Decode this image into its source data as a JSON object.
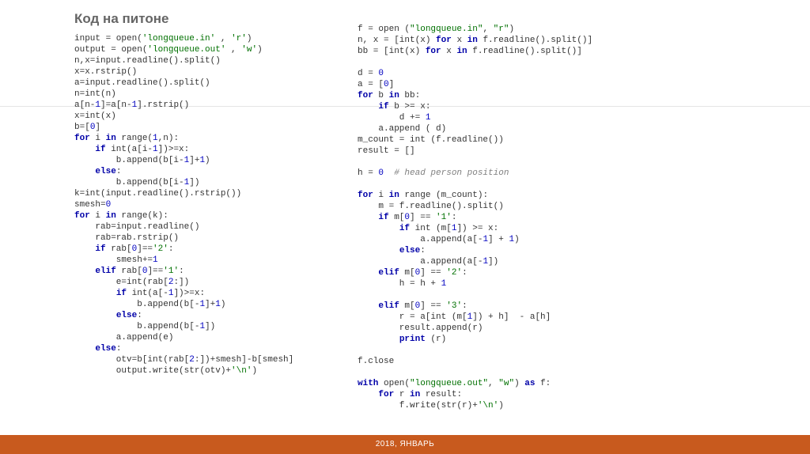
{
  "title": "Код на питоне",
  "footer": "2018, ЯНВАРЬ",
  "codeLeft": [
    {
      "segs": [
        [
          "",
          "input = open("
        ],
        [
          "str",
          "'longqueue.in'"
        ],
        [
          "",
          " , "
        ],
        [
          "str",
          "'r'"
        ],
        [
          "",
          ")"
        ]
      ]
    },
    {
      "segs": [
        [
          "",
          "output = open("
        ],
        [
          "str",
          "'longqueue.out'"
        ],
        [
          "",
          " , "
        ],
        [
          "str",
          "'w'"
        ],
        [
          "",
          ")"
        ]
      ]
    },
    {
      "segs": [
        [
          "",
          "n,x=input.readline().split()"
        ]
      ]
    },
    {
      "segs": [
        [
          "",
          "x=x.rstrip()"
        ]
      ]
    },
    {
      "segs": [
        [
          "",
          "a=input.readline().split()"
        ]
      ]
    },
    {
      "segs": [
        [
          "",
          "n=int(n)"
        ]
      ]
    },
    {
      "segs": [
        [
          "",
          "a[n-"
        ],
        [
          "num",
          "1"
        ],
        [
          "",
          "]=a[n-"
        ],
        [
          "num",
          "1"
        ],
        [
          "",
          "].rstrip()"
        ]
      ]
    },
    {
      "segs": [
        [
          "",
          "x=int(x)"
        ]
      ]
    },
    {
      "segs": [
        [
          "",
          "b=["
        ],
        [
          "num",
          "0"
        ],
        [
          "",
          "]"
        ]
      ]
    },
    {
      "segs": [
        [
          "kw",
          "for"
        ],
        [
          "",
          " i "
        ],
        [
          "kw",
          "in"
        ],
        [
          "",
          " range("
        ],
        [
          "num",
          "1"
        ],
        [
          "",
          ",n):"
        ]
      ]
    },
    {
      "segs": [
        [
          "",
          "    "
        ],
        [
          "kw",
          "if"
        ],
        [
          "",
          " int(a[i-"
        ],
        [
          "num",
          "1"
        ],
        [
          "",
          "])>=x:"
        ]
      ]
    },
    {
      "segs": [
        [
          "",
          "        b.append(b[i-"
        ],
        [
          "num",
          "1"
        ],
        [
          "",
          "]+"
        ],
        [
          "num",
          "1"
        ],
        [
          "",
          ")"
        ]
      ]
    },
    {
      "segs": [
        [
          "",
          "    "
        ],
        [
          "kw",
          "else"
        ],
        [
          "",
          ":"
        ]
      ]
    },
    {
      "segs": [
        [
          "",
          "        b.append(b[i-"
        ],
        [
          "num",
          "1"
        ],
        [
          "",
          "])"
        ]
      ]
    },
    {
      "segs": [
        [
          "",
          "k=int(input.readline().rstrip())"
        ]
      ]
    },
    {
      "segs": [
        [
          "",
          "smesh="
        ],
        [
          "num",
          "0"
        ]
      ]
    },
    {
      "segs": [
        [
          "kw",
          "for"
        ],
        [
          "",
          " i "
        ],
        [
          "kw",
          "in"
        ],
        [
          "",
          " range(k):"
        ]
      ]
    },
    {
      "segs": [
        [
          "",
          "    rab=input.readline()"
        ]
      ]
    },
    {
      "segs": [
        [
          "",
          "    rab=rab.rstrip()"
        ]
      ]
    },
    {
      "segs": [
        [
          "",
          "    "
        ],
        [
          "kw",
          "if"
        ],
        [
          "",
          " rab["
        ],
        [
          "num",
          "0"
        ],
        [
          "",
          "]=="
        ],
        [
          "str",
          "'2'"
        ],
        [
          "",
          ":"
        ]
      ]
    },
    {
      "segs": [
        [
          "",
          "        smesh+="
        ],
        [
          "num",
          "1"
        ]
      ]
    },
    {
      "segs": [
        [
          "",
          "    "
        ],
        [
          "kw",
          "elif"
        ],
        [
          "",
          " rab["
        ],
        [
          "num",
          "0"
        ],
        [
          "",
          "]=="
        ],
        [
          "str",
          "'1'"
        ],
        [
          "",
          ":"
        ]
      ]
    },
    {
      "segs": [
        [
          "",
          "        e=int(rab["
        ],
        [
          "num",
          "2"
        ],
        [
          "",
          ":])"
        ]
      ]
    },
    {
      "segs": [
        [
          "",
          "        "
        ],
        [
          "kw",
          "if"
        ],
        [
          "",
          " int(a[-"
        ],
        [
          "num",
          "1"
        ],
        [
          "",
          "])>=x:"
        ]
      ]
    },
    {
      "segs": [
        [
          "",
          "            b.append(b[-"
        ],
        [
          "num",
          "1"
        ],
        [
          "",
          "]+"
        ],
        [
          "num",
          "1"
        ],
        [
          "",
          ")"
        ]
      ]
    },
    {
      "segs": [
        [
          "",
          "        "
        ],
        [
          "kw",
          "else"
        ],
        [
          "",
          ":"
        ]
      ]
    },
    {
      "segs": [
        [
          "",
          "            b.append(b[-"
        ],
        [
          "num",
          "1"
        ],
        [
          "",
          "])"
        ]
      ]
    },
    {
      "segs": [
        [
          "",
          "        a.append(e)"
        ]
      ]
    },
    {
      "segs": [
        [
          "",
          "    "
        ],
        [
          "kw",
          "else"
        ],
        [
          "",
          ":"
        ]
      ]
    },
    {
      "segs": [
        [
          "",
          "        otv=b[int(rab["
        ],
        [
          "num",
          "2"
        ],
        [
          "",
          ":])+smesh]-b[smesh]"
        ]
      ]
    },
    {
      "segs": [
        [
          "",
          "        output.write(str(otv)+"
        ],
        [
          "str",
          "'\\n'"
        ],
        [
          "",
          ")"
        ]
      ]
    }
  ],
  "codeRight": [
    {
      "segs": [
        [
          "",
          "f = open ("
        ],
        [
          "str",
          "\"longqueue.in\""
        ],
        [
          "",
          ", "
        ],
        [
          "str",
          "\"r\""
        ],
        [
          "",
          ")"
        ]
      ]
    },
    {
      "segs": [
        [
          "",
          "n, x = [int(x) "
        ],
        [
          "kw",
          "for"
        ],
        [
          "",
          " x "
        ],
        [
          "kw",
          "in"
        ],
        [
          "",
          " f.readline().split()]"
        ]
      ]
    },
    {
      "segs": [
        [
          "",
          "bb = [int(x) "
        ],
        [
          "kw",
          "for"
        ],
        [
          "",
          " x "
        ],
        [
          "kw",
          "in"
        ],
        [
          "",
          " f.readline().split()]"
        ]
      ]
    },
    {
      "segs": [
        [
          "",
          ""
        ]
      ]
    },
    {
      "segs": [
        [
          "",
          "d = "
        ],
        [
          "num",
          "0"
        ]
      ]
    },
    {
      "segs": [
        [
          "",
          "a = ["
        ],
        [
          "num",
          "0"
        ],
        [
          "",
          "]"
        ]
      ]
    },
    {
      "segs": [
        [
          "kw",
          "for"
        ],
        [
          "",
          " b "
        ],
        [
          "kw",
          "in"
        ],
        [
          "",
          " bb:"
        ]
      ]
    },
    {
      "segs": [
        [
          "",
          "    "
        ],
        [
          "kw",
          "if"
        ],
        [
          "",
          " b >= x:"
        ]
      ]
    },
    {
      "segs": [
        [
          "",
          "        d += "
        ],
        [
          "num",
          "1"
        ]
      ]
    },
    {
      "segs": [
        [
          "",
          "    a.append ( d)"
        ]
      ]
    },
    {
      "segs": [
        [
          "",
          "m_count = int (f.readline())"
        ]
      ]
    },
    {
      "segs": [
        [
          "",
          "result = []"
        ]
      ]
    },
    {
      "segs": [
        [
          "",
          ""
        ]
      ]
    },
    {
      "segs": [
        [
          "",
          "h = "
        ],
        [
          "num",
          "0"
        ],
        [
          "",
          "  "
        ],
        [
          "cmt",
          "# head person position"
        ]
      ]
    },
    {
      "segs": [
        [
          "",
          ""
        ]
      ]
    },
    {
      "segs": [
        [
          "kw",
          "for"
        ],
        [
          "",
          " i "
        ],
        [
          "kw",
          "in"
        ],
        [
          "",
          " range (m_count):"
        ]
      ]
    },
    {
      "segs": [
        [
          "",
          "    m = f.readline().split()"
        ]
      ]
    },
    {
      "segs": [
        [
          "",
          "    "
        ],
        [
          "kw",
          "if"
        ],
        [
          "",
          " m["
        ],
        [
          "num",
          "0"
        ],
        [
          "",
          "] == "
        ],
        [
          "str",
          "'1'"
        ],
        [
          "",
          ":"
        ]
      ]
    },
    {
      "segs": [
        [
          "",
          "        "
        ],
        [
          "kw",
          "if"
        ],
        [
          "",
          " int (m["
        ],
        [
          "num",
          "1"
        ],
        [
          "",
          "]) >= x:"
        ]
      ]
    },
    {
      "segs": [
        [
          "",
          "            a.append(a[-"
        ],
        [
          "num",
          "1"
        ],
        [
          "",
          "] + "
        ],
        [
          "num",
          "1"
        ],
        [
          "",
          ")"
        ]
      ]
    },
    {
      "segs": [
        [
          "",
          "        "
        ],
        [
          "kw",
          "else"
        ],
        [
          "",
          ":"
        ]
      ]
    },
    {
      "segs": [
        [
          "",
          "            a.append(a[-"
        ],
        [
          "num",
          "1"
        ],
        [
          "",
          "])"
        ]
      ]
    },
    {
      "segs": [
        [
          "",
          "    "
        ],
        [
          "kw",
          "elif"
        ],
        [
          "",
          " m["
        ],
        [
          "num",
          "0"
        ],
        [
          "",
          "] == "
        ],
        [
          "str",
          "'2'"
        ],
        [
          "",
          ":"
        ]
      ]
    },
    {
      "segs": [
        [
          "",
          "        h = h + "
        ],
        [
          "num",
          "1"
        ]
      ]
    },
    {
      "segs": [
        [
          "",
          ""
        ]
      ]
    },
    {
      "segs": [
        [
          "",
          "    "
        ],
        [
          "kw",
          "elif"
        ],
        [
          "",
          " m["
        ],
        [
          "num",
          "0"
        ],
        [
          "",
          "] == "
        ],
        [
          "str",
          "'3'"
        ],
        [
          "",
          ":"
        ]
      ]
    },
    {
      "segs": [
        [
          "",
          "        r = a[int (m["
        ],
        [
          "num",
          "1"
        ],
        [
          "",
          "]) + h]  - a[h]"
        ]
      ]
    },
    {
      "segs": [
        [
          "",
          "        result.append(r)"
        ]
      ]
    },
    {
      "segs": [
        [
          "",
          "        "
        ],
        [
          "kw",
          "print"
        ],
        [
          "",
          " (r)"
        ]
      ]
    },
    {
      "segs": [
        [
          "",
          ""
        ]
      ]
    },
    {
      "segs": [
        [
          "",
          "f.close"
        ]
      ]
    },
    {
      "segs": [
        [
          "",
          ""
        ]
      ]
    },
    {
      "segs": [
        [
          "kw",
          "with"
        ],
        [
          "",
          " open("
        ],
        [
          "str",
          "\"longqueue.out\""
        ],
        [
          "",
          ", "
        ],
        [
          "str",
          "\"w\""
        ],
        [
          "",
          ") "
        ],
        [
          "kw",
          "as"
        ],
        [
          "",
          " f:"
        ]
      ]
    },
    {
      "segs": [
        [
          "",
          "    "
        ],
        [
          "kw",
          "for"
        ],
        [
          "",
          " r "
        ],
        [
          "kw",
          "in"
        ],
        [
          "",
          " result:"
        ]
      ]
    },
    {
      "segs": [
        [
          "",
          "        f.write(str(r)+"
        ],
        [
          "str",
          "'\\n'"
        ],
        [
          "",
          ")"
        ]
      ]
    }
  ]
}
